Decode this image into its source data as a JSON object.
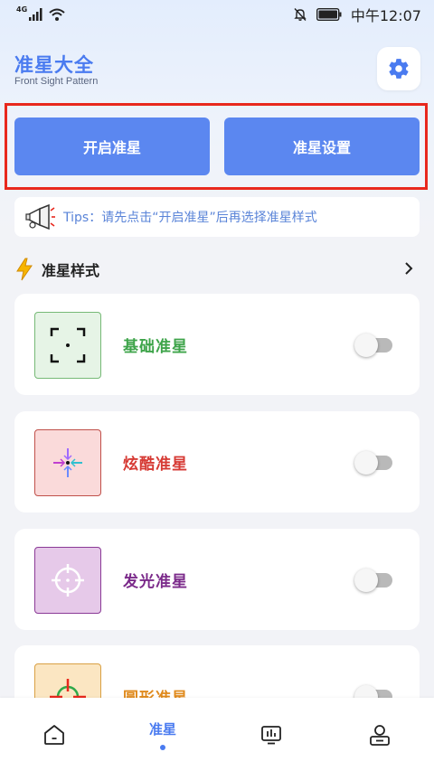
{
  "status_bar": {
    "network_label": "4G",
    "time": "中午12:07"
  },
  "header": {
    "title": "准星大全",
    "subtitle": "Front Sight Pattern",
    "settings_icon": "gear-icon"
  },
  "actions": {
    "start_label": "开启准星",
    "settings_label": "准星设置"
  },
  "tips": {
    "text": "Tips：请先点击“开启准星”后再选择准星样式"
  },
  "section": {
    "title": "准星样式"
  },
  "styles": [
    {
      "label": "基础准星",
      "color": "#3ea44a",
      "enabled": false
    },
    {
      "label": "炫酷准星",
      "color": "#d63a34",
      "enabled": false
    },
    {
      "label": "发光准星",
      "color": "#7b2a8a",
      "enabled": false
    },
    {
      "label": "圆形准星",
      "color": "#e08a1c",
      "enabled": false
    }
  ],
  "bottom_nav": {
    "items": [
      {
        "icon": "home-icon"
      },
      {
        "label": "准星",
        "active": true
      },
      {
        "icon": "stats-icon"
      },
      {
        "icon": "profile-icon"
      }
    ]
  },
  "colors": {
    "accent": "#4a7bf0",
    "button": "#5b87f0",
    "highlight": "#e8281d"
  }
}
